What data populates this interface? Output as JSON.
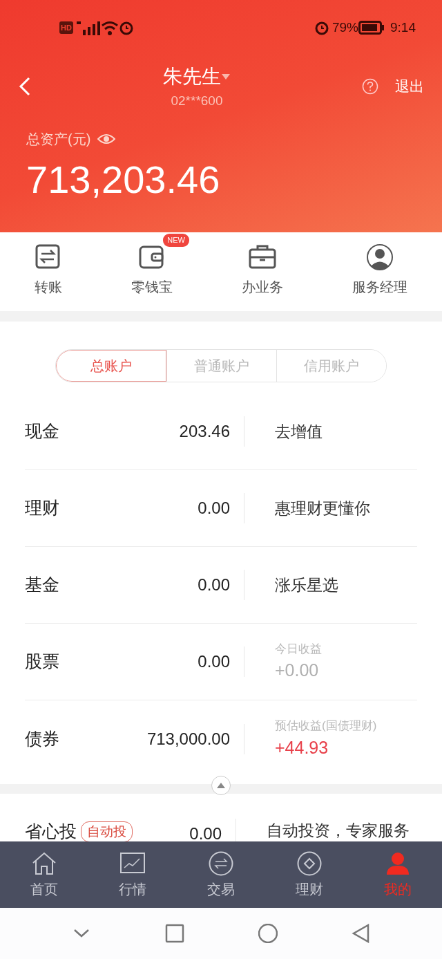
{
  "status_bar": {
    "left": "HD",
    "battery": "79%",
    "time": "9:14"
  },
  "header": {
    "name": "朱先生",
    "account": "02***600",
    "logout": "退出",
    "total_label": "总资产(元)",
    "total": "713,203.46"
  },
  "shortcuts": [
    {
      "kind": "transfer",
      "label": "转账"
    },
    {
      "kind": "wallet",
      "label": "零钱宝",
      "badge": "NEW"
    },
    {
      "kind": "briefcase",
      "label": "办业务"
    },
    {
      "kind": "manager",
      "label": "服务经理"
    }
  ],
  "account_tabs": [
    {
      "label": "总账户",
      "selected": true
    },
    {
      "label": "普通账户",
      "selected": false
    },
    {
      "label": "信用账户",
      "selected": false
    }
  ],
  "rows": [
    {
      "name": "现金",
      "amount": "203.46",
      "kind": "link",
      "text": "去增值"
    },
    {
      "name": "理财",
      "amount": "0.00",
      "kind": "link",
      "text": "惠理财更懂你"
    },
    {
      "name": "基金",
      "amount": "0.00",
      "kind": "link",
      "text": "涨乐星选"
    },
    {
      "name": "股票",
      "amount": "0.00",
      "kind": "income",
      "label": "今日收益",
      "value": "+0.00",
      "color": "#b0b0b0"
    },
    {
      "name": "债券",
      "amount": "713,000.00",
      "kind": "income",
      "label": "预估收益(国债理财)",
      "value": "+44.93",
      "color": "#e8404a"
    }
  ],
  "extra_row": {
    "name": "省心投",
    "tag": "自动投",
    "amount": "0.00",
    "text": "自动投资，专家服务"
  },
  "bottom_nav": [
    {
      "kind": "home",
      "label": "首页",
      "selected": false
    },
    {
      "kind": "chart",
      "label": "行情",
      "selected": false
    },
    {
      "kind": "trade",
      "label": "交易",
      "selected": false
    },
    {
      "kind": "finance",
      "label": "理财",
      "selected": false
    },
    {
      "kind": "me",
      "label": "我的",
      "selected": true
    }
  ]
}
